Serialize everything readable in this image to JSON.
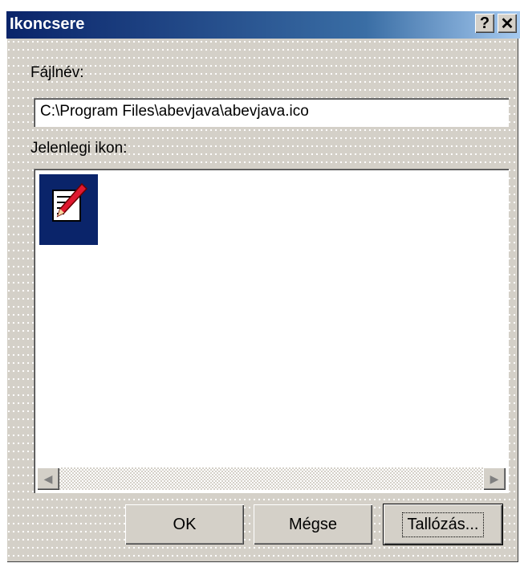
{
  "window": {
    "title": "Ikoncsere",
    "help_label": "?",
    "close_label": "✕"
  },
  "filename": {
    "label": "Fájlnév:",
    "value": "C:\\Program Files\\abevjava\\abevjava.ico"
  },
  "current_icon": {
    "label": "Jelenlegi ikon:",
    "selected_icon": "edit-document-pencil-icon"
  },
  "scrollbar": {
    "left_arrow": "◀",
    "right_arrow": "▶"
  },
  "buttons": {
    "ok": "OK",
    "cancel": "Mégse",
    "browse": "Tallózás..."
  },
  "colors": {
    "title_start": "#0a246a",
    "title_end": "#a6caf0",
    "selection": "#0a246a",
    "face": "#d4d0c8"
  }
}
